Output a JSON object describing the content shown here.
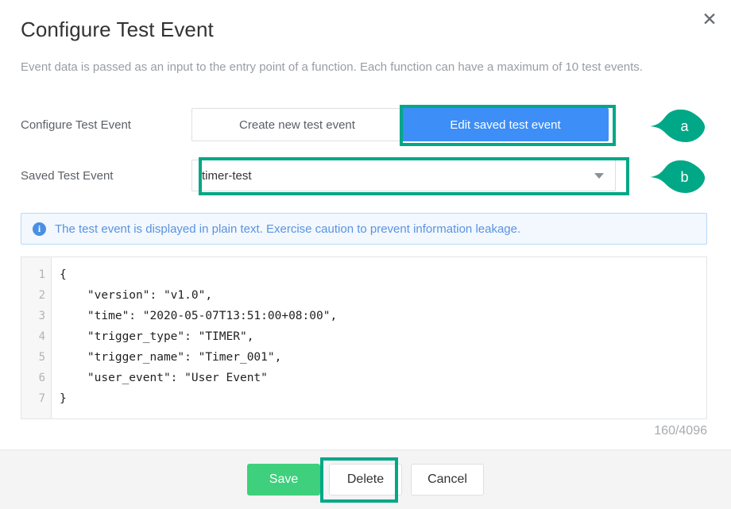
{
  "dialog": {
    "title": "Configure Test Event",
    "description": "Event data is passed as an input to the entry point of a function. Each function can have a maximum of 10 test events.",
    "close_icon": "close-icon",
    "close_glyph": "✕"
  },
  "form": {
    "row_configure": {
      "label": "Configure Test Event",
      "segments": [
        {
          "label": "Create new test event",
          "active": false
        },
        {
          "label": "Edit saved test event",
          "active": true
        }
      ]
    },
    "row_saved": {
      "label": "Saved Test Event",
      "value": "timer-test",
      "caret_icon": "chevron-down-icon"
    }
  },
  "info_banner": {
    "icon": "info-circle-icon",
    "icon_glyph": "i",
    "text": "The test event is displayed in plain text. Exercise caution to prevent information leakage."
  },
  "editor": {
    "line_numbers": [
      "1",
      "2",
      "3",
      "4",
      "5",
      "6",
      "7"
    ],
    "lines": [
      "{",
      "    \"version\": \"v1.0\",",
      "    \"time\": \"2020-05-07T13:51:00+08:00\",",
      "    \"trigger_type\": \"TIMER\",",
      "    \"trigger_name\": \"Timer_001\",",
      "    \"user_event\": \"User Event\"",
      "}"
    ],
    "char_counter": "160/4096"
  },
  "footer": {
    "save_label": "Save",
    "delete_label": "Delete",
    "cancel_label": "Cancel"
  },
  "annotations": {
    "marker_a": "a",
    "marker_b": "b",
    "highlight_color": "#00a887",
    "marker_color": "#00a887"
  },
  "colors": {
    "accent_blue": "#3d8ef7",
    "save_green": "#3ed07c",
    "annotation_teal": "#00a887",
    "info_blue": "#4a90e2"
  }
}
